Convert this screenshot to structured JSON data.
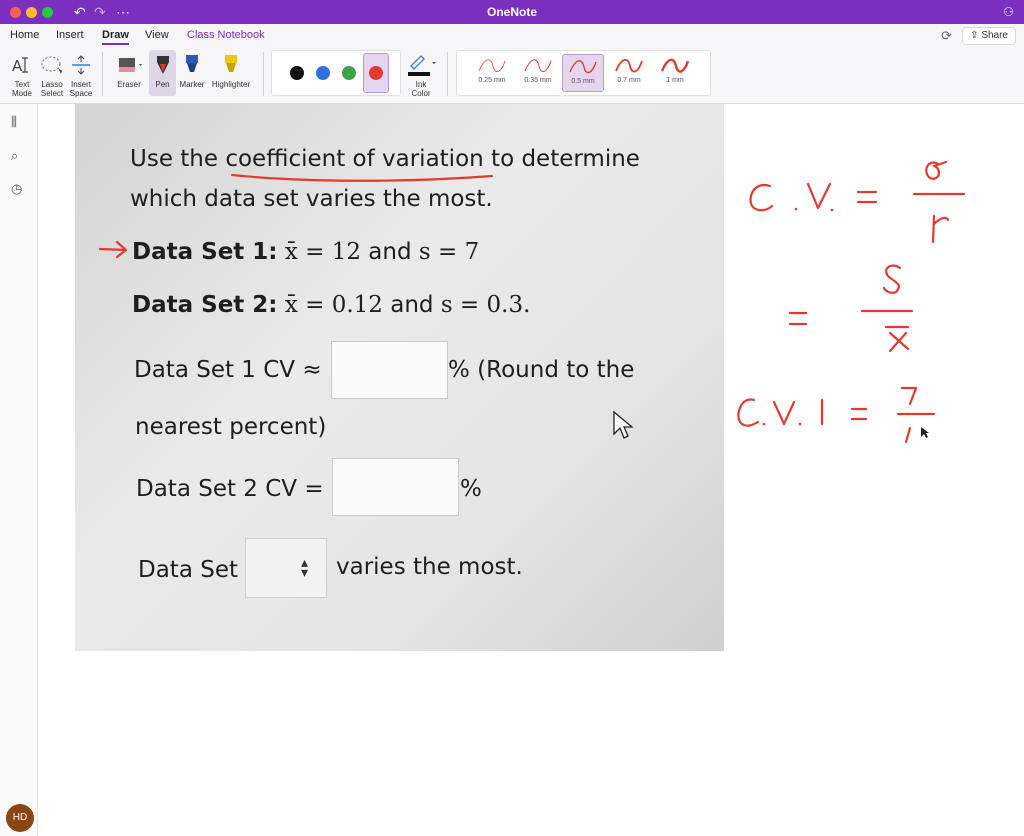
{
  "titlebar": {
    "app_title": "OneNote"
  },
  "menu": {
    "tabs": [
      "Home",
      "Insert",
      "Draw",
      "View",
      "Class Notebook"
    ],
    "share_label": "Share"
  },
  "ribbon": {
    "text_mode": [
      "Text",
      "Mode"
    ],
    "lasso_select": [
      "Lasso",
      "Select"
    ],
    "insert_space": [
      "Insert",
      "Space"
    ],
    "eraser": "Eraser",
    "pen": "Pen",
    "marker": "Marker",
    "highlighter": "Highlighter",
    "ink_color": [
      "Ink",
      "Color"
    ],
    "colors": [
      "#111111",
      "#2f6fde",
      "#3aa34a",
      "#e23b2e"
    ],
    "stroke_sizes": [
      "0.25 mm",
      "0.35 mm",
      "0.5 mm",
      "0.7 mm",
      "1 mm"
    ]
  },
  "question": {
    "line1_prefix": "Use the",
    "line1_link": "coefficient of variation",
    "line1_suffix": "to determine",
    "line2": "which data set varies the most.",
    "ds1_label": "Data Set 1:",
    "ds1_xbar": "x̄ = 12",
    "ds1_and": "and",
    "ds1_s": "s = 7",
    "ds2_label": "Data Set 2:",
    "ds2_xbar": "x̄ = 0.12",
    "ds2_and": "and",
    "ds2_s": "s = 0.3.",
    "cv1_label": "Data Set 1 CV ≈",
    "cv1_suffix": "% (Round to the",
    "cv1_line2": "nearest percent)",
    "cv2_label": "Data Set 2 CV =",
    "cv2_suffix": "%",
    "ds_prefix": "Data Set",
    "ds_suffix": "varies the most."
  },
  "avatar": {
    "initials": "HD"
  },
  "ink_color": "#e23b2e"
}
